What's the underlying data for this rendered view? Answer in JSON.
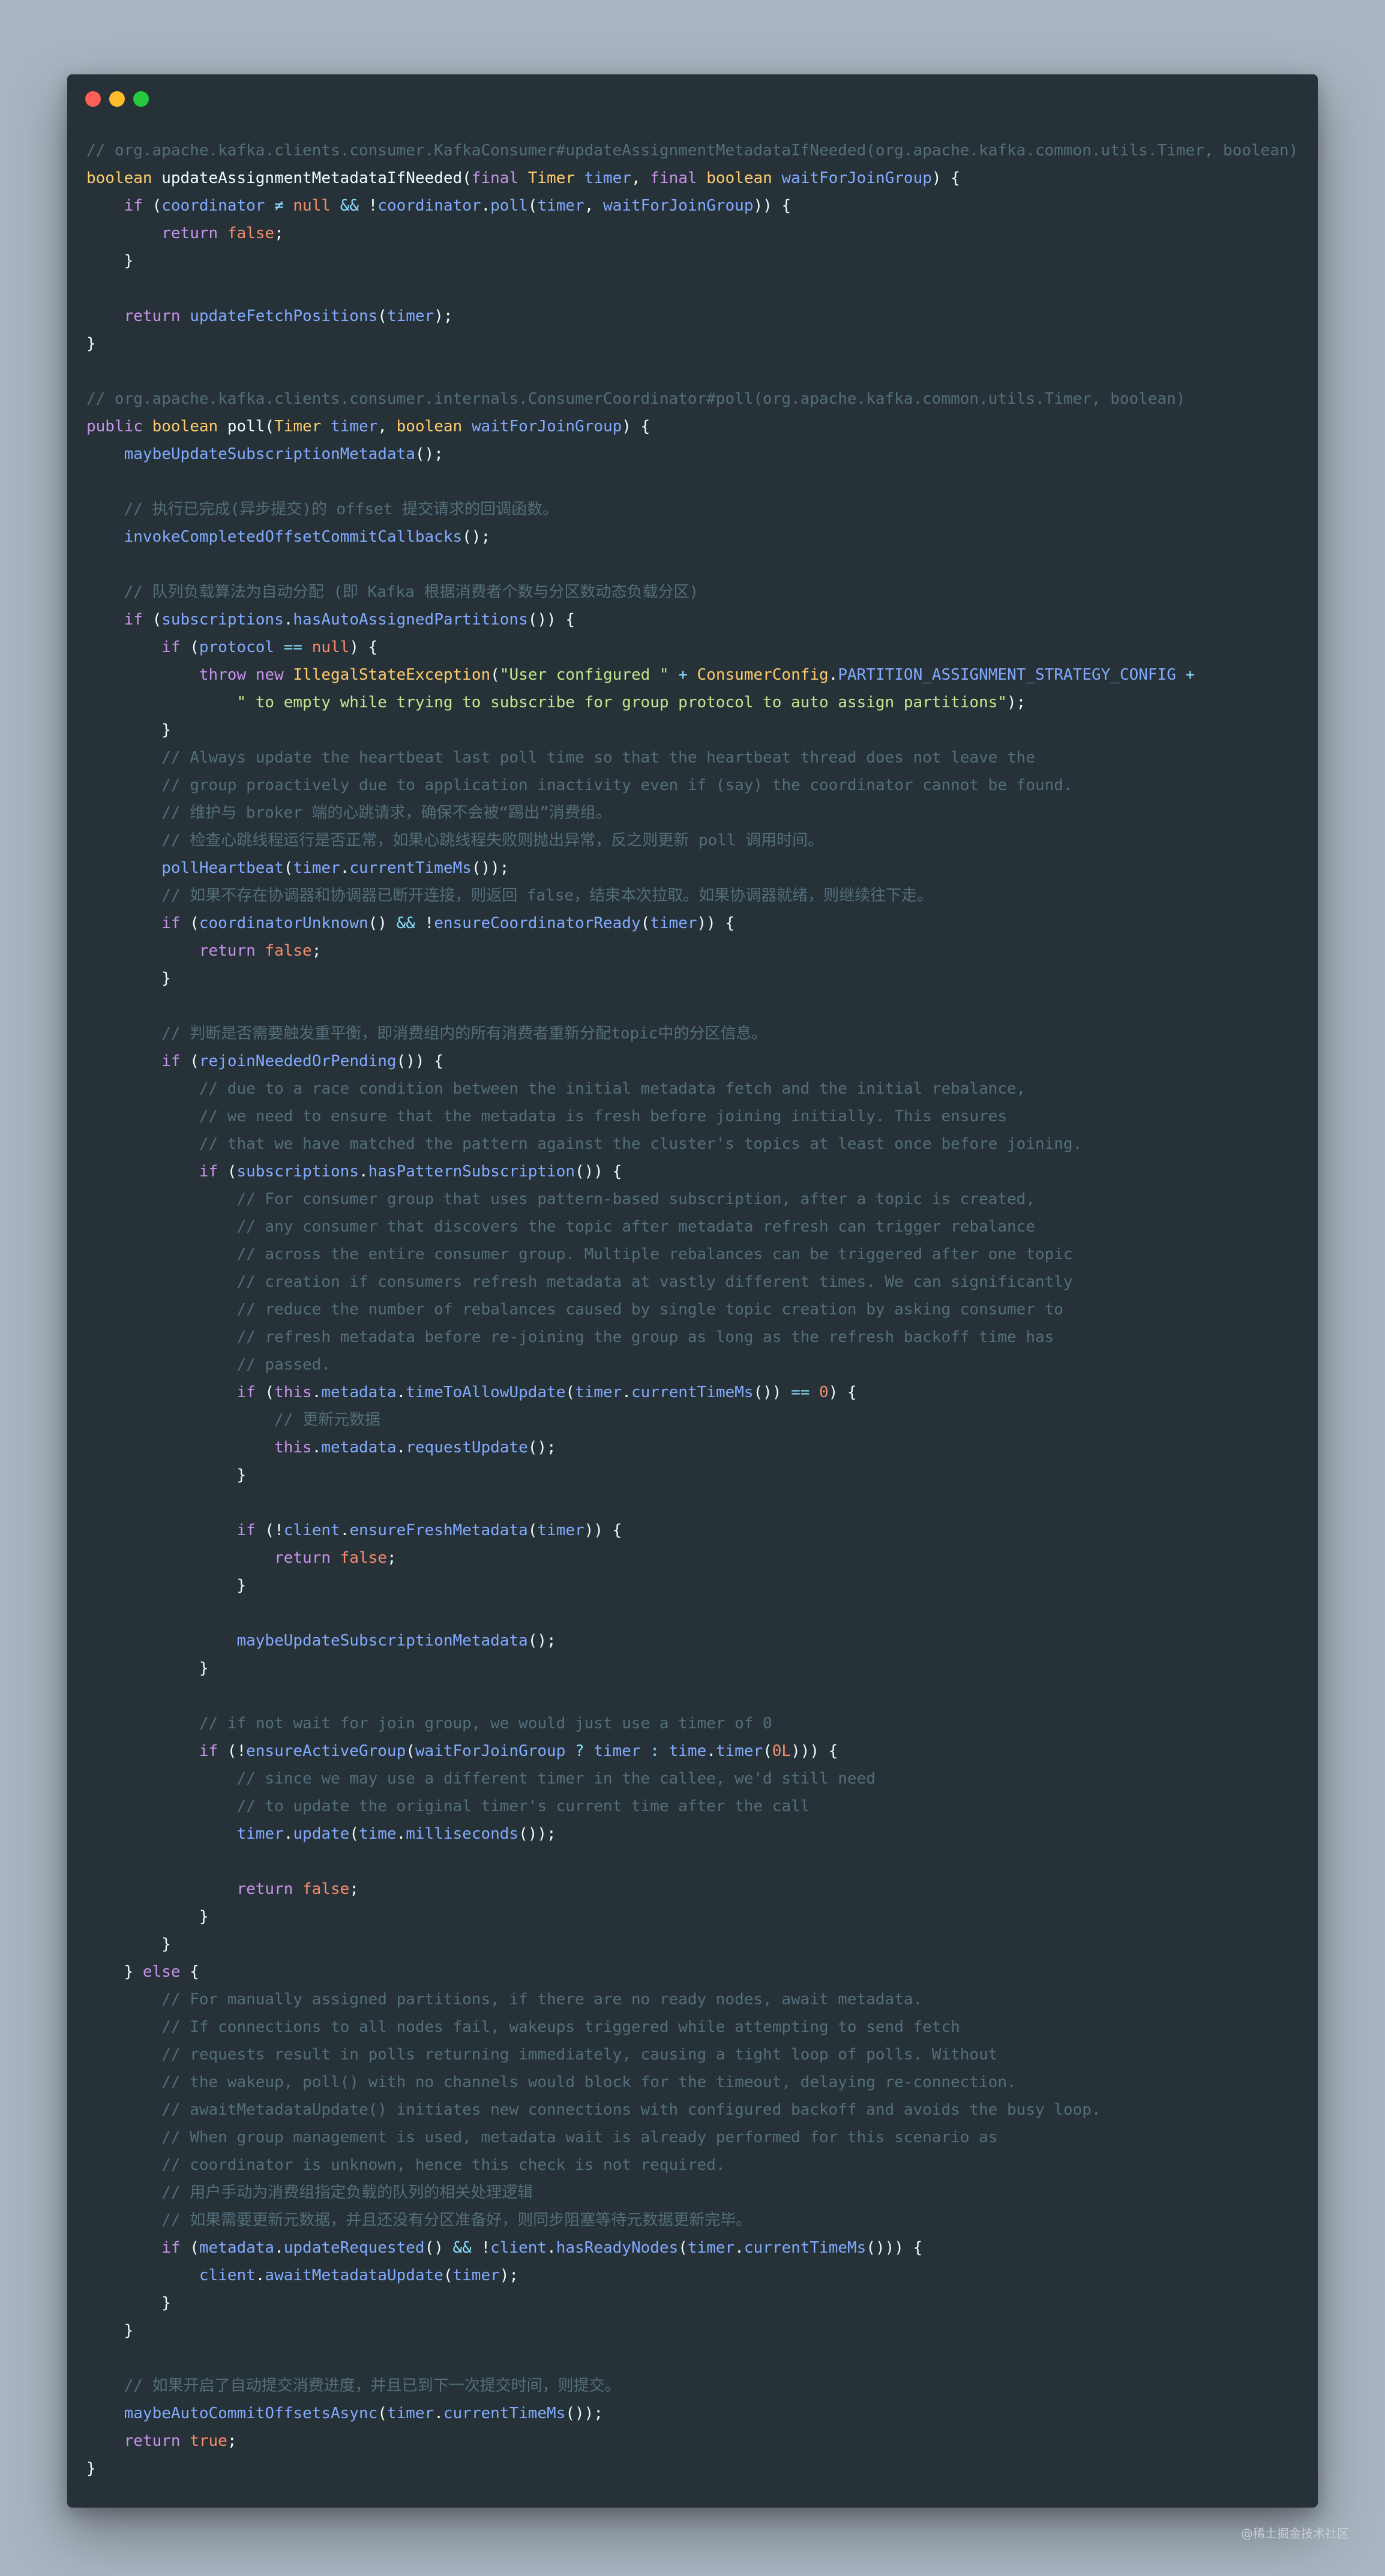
{
  "colors": {
    "background": "#a8b4c0",
    "window_bg": "#263238",
    "dot_red": "#ff5f56",
    "dot_yellow": "#ffbd2e",
    "dot_green": "#27c93f",
    "comment": "#546e7a",
    "keyword": "#c792ea",
    "type": "#ffcb6b",
    "field": "#82aaff",
    "string": "#c3e88d",
    "number": "#f78c6c",
    "operator": "#89ddff",
    "text": "#eeffff"
  },
  "window": {
    "controls": [
      "close-dot",
      "minimize-dot",
      "maximize-dot"
    ]
  },
  "watermark": "@稀土掘金技术社区",
  "code_lines": [
    [
      [
        "c",
        "// org.apache.kafka.clients.consumer.KafkaConsumer#updateAssignmentMetadataIfNeeded(org.apache.kafka.common.utils.Timer, boolean)"
      ]
    ],
    [
      [
        "t",
        "boolean"
      ],
      [
        "x",
        " updateAssignmentMetadataIfNeeded("
      ],
      [
        "k",
        "final"
      ],
      [
        "x",
        " "
      ],
      [
        "t",
        "Timer"
      ],
      [
        "x",
        " "
      ],
      [
        "p",
        "timer"
      ],
      [
        "x",
        ", "
      ],
      [
        "k",
        "final"
      ],
      [
        "x",
        " "
      ],
      [
        "t",
        "boolean"
      ],
      [
        "x",
        " "
      ],
      [
        "p",
        "waitForJoinGroup"
      ],
      [
        "x",
        ") {"
      ]
    ],
    [
      [
        "x",
        "    "
      ],
      [
        "k",
        "if"
      ],
      [
        "x",
        " ("
      ],
      [
        "f",
        "coordinator"
      ],
      [
        "x",
        " "
      ],
      [
        "o",
        "≠"
      ],
      [
        "x",
        " "
      ],
      [
        "n",
        "null"
      ],
      [
        "x",
        " "
      ],
      [
        "o",
        "&&"
      ],
      [
        "x",
        " !"
      ],
      [
        "f",
        "coordinator"
      ],
      [
        "x",
        "."
      ],
      [
        "m",
        "poll"
      ],
      [
        "x",
        "("
      ],
      [
        "p",
        "timer"
      ],
      [
        "x",
        ", "
      ],
      [
        "p",
        "waitForJoinGroup"
      ],
      [
        "x",
        ")) {"
      ]
    ],
    [
      [
        "x",
        "        "
      ],
      [
        "k",
        "return"
      ],
      [
        "x",
        " "
      ],
      [
        "n",
        "false"
      ],
      [
        "x",
        ";"
      ]
    ],
    [
      [
        "x",
        "    }"
      ]
    ],
    [],
    [
      [
        "x",
        "    "
      ],
      [
        "k",
        "return"
      ],
      [
        "x",
        " "
      ],
      [
        "m",
        "updateFetchPositions"
      ],
      [
        "x",
        "("
      ],
      [
        "p",
        "timer"
      ],
      [
        "x",
        ");"
      ]
    ],
    [
      [
        "x",
        "}"
      ]
    ],
    [],
    [
      [
        "c",
        "// org.apache.kafka.clients.consumer.internals.ConsumerCoordinator#poll(org.apache.kafka.common.utils.Timer, boolean)"
      ]
    ],
    [
      [
        "k",
        "public"
      ],
      [
        "x",
        " "
      ],
      [
        "t",
        "boolean"
      ],
      [
        "x",
        " poll("
      ],
      [
        "t",
        "Timer"
      ],
      [
        "x",
        " "
      ],
      [
        "p",
        "timer"
      ],
      [
        "x",
        ", "
      ],
      [
        "t",
        "boolean"
      ],
      [
        "x",
        " "
      ],
      [
        "p",
        "waitForJoinGroup"
      ],
      [
        "x",
        ") {"
      ]
    ],
    [
      [
        "x",
        "    "
      ],
      [
        "m",
        "maybeUpdateSubscriptionMetadata"
      ],
      [
        "x",
        "();"
      ]
    ],
    [],
    [
      [
        "x",
        "    "
      ],
      [
        "c",
        "// 执行已完成(异步提交)的 offset 提交请求的回调函数。"
      ]
    ],
    [
      [
        "x",
        "    "
      ],
      [
        "m",
        "invokeCompletedOffsetCommitCallbacks"
      ],
      [
        "x",
        "();"
      ]
    ],
    [],
    [
      [
        "x",
        "    "
      ],
      [
        "c",
        "// 队列负载算法为自动分配 (即 Kafka 根据消费者个数与分区数动态负载分区)"
      ]
    ],
    [
      [
        "x",
        "    "
      ],
      [
        "k",
        "if"
      ],
      [
        "x",
        " ("
      ],
      [
        "f",
        "subscriptions"
      ],
      [
        "x",
        "."
      ],
      [
        "m",
        "hasAutoAssignedPartitions"
      ],
      [
        "x",
        "()) {"
      ]
    ],
    [
      [
        "x",
        "        "
      ],
      [
        "k",
        "if"
      ],
      [
        "x",
        " ("
      ],
      [
        "f",
        "protocol"
      ],
      [
        "x",
        " "
      ],
      [
        "o",
        "=="
      ],
      [
        "x",
        " "
      ],
      [
        "n",
        "null"
      ],
      [
        "x",
        ") {"
      ]
    ],
    [
      [
        "x",
        "            "
      ],
      [
        "k",
        "throw"
      ],
      [
        "x",
        " "
      ],
      [
        "k",
        "new"
      ],
      [
        "x",
        " "
      ],
      [
        "t",
        "IllegalStateException"
      ],
      [
        "x",
        "("
      ],
      [
        "s",
        "\"User configured \""
      ],
      [
        "x",
        " "
      ],
      [
        "o",
        "+"
      ],
      [
        "x",
        " "
      ],
      [
        "t",
        "ConsumerConfig"
      ],
      [
        "x",
        "."
      ],
      [
        "f",
        "PARTITION_ASSIGNMENT_STRATEGY_CONFIG"
      ],
      [
        "x",
        " "
      ],
      [
        "o",
        "+"
      ]
    ],
    [
      [
        "x",
        "                "
      ],
      [
        "s",
        "\" to empty while trying to subscribe for group protocol to auto assign partitions\""
      ],
      [
        "x",
        ");"
      ]
    ],
    [
      [
        "x",
        "        }"
      ]
    ],
    [
      [
        "x",
        "        "
      ],
      [
        "c",
        "// Always update the heartbeat last poll time so that the heartbeat thread does not leave the"
      ]
    ],
    [
      [
        "x",
        "        "
      ],
      [
        "c",
        "// group proactively due to application inactivity even if (say) the coordinator cannot be found."
      ]
    ],
    [
      [
        "x",
        "        "
      ],
      [
        "c",
        "// 维护与 broker 端的心跳请求，确保不会被“踢出”消费组。"
      ]
    ],
    [
      [
        "x",
        "        "
      ],
      [
        "c",
        "// 检查心跳线程运行是否正常，如果心跳线程失败则抛出异常，反之则更新 poll 调用时间。"
      ]
    ],
    [
      [
        "x",
        "        "
      ],
      [
        "m",
        "pollHeartbeat"
      ],
      [
        "x",
        "("
      ],
      [
        "p",
        "timer"
      ],
      [
        "x",
        "."
      ],
      [
        "m",
        "currentTimeMs"
      ],
      [
        "x",
        "());"
      ]
    ],
    [
      [
        "x",
        "        "
      ],
      [
        "c",
        "// 如果不存在协调器和协调器已断开连接，则返回 false，结束本次拉取。如果协调器就绪，则继续往下走。"
      ]
    ],
    [
      [
        "x",
        "        "
      ],
      [
        "k",
        "if"
      ],
      [
        "x",
        " ("
      ],
      [
        "m",
        "coordinatorUnknown"
      ],
      [
        "x",
        "() "
      ],
      [
        "o",
        "&&"
      ],
      [
        "x",
        " !"
      ],
      [
        "m",
        "ensureCoordinatorReady"
      ],
      [
        "x",
        "("
      ],
      [
        "p",
        "timer"
      ],
      [
        "x",
        ")) {"
      ]
    ],
    [
      [
        "x",
        "            "
      ],
      [
        "k",
        "return"
      ],
      [
        "x",
        " "
      ],
      [
        "n",
        "false"
      ],
      [
        "x",
        ";"
      ]
    ],
    [
      [
        "x",
        "        }"
      ]
    ],
    [],
    [
      [
        "x",
        "        "
      ],
      [
        "c",
        "// 判断是否需要触发重平衡，即消费组内的所有消费者重新分配topic中的分区信息。"
      ]
    ],
    [
      [
        "x",
        "        "
      ],
      [
        "k",
        "if"
      ],
      [
        "x",
        " ("
      ],
      [
        "m",
        "rejoinNeededOrPending"
      ],
      [
        "x",
        "()) {"
      ]
    ],
    [
      [
        "x",
        "            "
      ],
      [
        "c",
        "// due to a race condition between the initial metadata fetch and the initial rebalance,"
      ]
    ],
    [
      [
        "x",
        "            "
      ],
      [
        "c",
        "// we need to ensure that the metadata is fresh before joining initially. This ensures"
      ]
    ],
    [
      [
        "x",
        "            "
      ],
      [
        "c",
        "// that we have matched the pattern against the cluster's topics at least once before joining."
      ]
    ],
    [
      [
        "x",
        "            "
      ],
      [
        "k",
        "if"
      ],
      [
        "x",
        " ("
      ],
      [
        "f",
        "subscriptions"
      ],
      [
        "x",
        "."
      ],
      [
        "m",
        "hasPatternSubscription"
      ],
      [
        "x",
        "()) {"
      ]
    ],
    [
      [
        "x",
        "                "
      ],
      [
        "c",
        "// For consumer group that uses pattern-based subscription, after a topic is created,"
      ]
    ],
    [
      [
        "x",
        "                "
      ],
      [
        "c",
        "// any consumer that discovers the topic after metadata refresh can trigger rebalance"
      ]
    ],
    [
      [
        "x",
        "                "
      ],
      [
        "c",
        "// across the entire consumer group. Multiple rebalances can be triggered after one topic"
      ]
    ],
    [
      [
        "x",
        "                "
      ],
      [
        "c",
        "// creation if consumers refresh metadata at vastly different times. We can significantly"
      ]
    ],
    [
      [
        "x",
        "                "
      ],
      [
        "c",
        "// reduce the number of rebalances caused by single topic creation by asking consumer to"
      ]
    ],
    [
      [
        "x",
        "                "
      ],
      [
        "c",
        "// refresh metadata before re-joining the group as long as the refresh backoff time has"
      ]
    ],
    [
      [
        "x",
        "                "
      ],
      [
        "c",
        "// passed."
      ]
    ],
    [
      [
        "x",
        "                "
      ],
      [
        "k",
        "if"
      ],
      [
        "x",
        " ("
      ],
      [
        "k",
        "this"
      ],
      [
        "x",
        "."
      ],
      [
        "f",
        "metadata"
      ],
      [
        "x",
        "."
      ],
      [
        "m",
        "timeToAllowUpdate"
      ],
      [
        "x",
        "("
      ],
      [
        "p",
        "timer"
      ],
      [
        "x",
        "."
      ],
      [
        "m",
        "currentTimeMs"
      ],
      [
        "x",
        "()) "
      ],
      [
        "o",
        "=="
      ],
      [
        "x",
        " "
      ],
      [
        "n",
        "0"
      ],
      [
        "x",
        ") {"
      ]
    ],
    [
      [
        "x",
        "                    "
      ],
      [
        "c",
        "// 更新元数据"
      ]
    ],
    [
      [
        "x",
        "                    "
      ],
      [
        "k",
        "this"
      ],
      [
        "x",
        "."
      ],
      [
        "f",
        "metadata"
      ],
      [
        "x",
        "."
      ],
      [
        "m",
        "requestUpdate"
      ],
      [
        "x",
        "();"
      ]
    ],
    [
      [
        "x",
        "                }"
      ]
    ],
    [],
    [
      [
        "x",
        "                "
      ],
      [
        "k",
        "if"
      ],
      [
        "x",
        " (!"
      ],
      [
        "f",
        "client"
      ],
      [
        "x",
        "."
      ],
      [
        "m",
        "ensureFreshMetadata"
      ],
      [
        "x",
        "("
      ],
      [
        "p",
        "timer"
      ],
      [
        "x",
        ")) {"
      ]
    ],
    [
      [
        "x",
        "                    "
      ],
      [
        "k",
        "return"
      ],
      [
        "x",
        " "
      ],
      [
        "n",
        "false"
      ],
      [
        "x",
        ";"
      ]
    ],
    [
      [
        "x",
        "                }"
      ]
    ],
    [],
    [
      [
        "x",
        "                "
      ],
      [
        "m",
        "maybeUpdateSubscriptionMetadata"
      ],
      [
        "x",
        "();"
      ]
    ],
    [
      [
        "x",
        "            }"
      ]
    ],
    [],
    [
      [
        "x",
        "            "
      ],
      [
        "c",
        "// if not wait for join group, we would just use a timer of 0"
      ]
    ],
    [
      [
        "x",
        "            "
      ],
      [
        "k",
        "if"
      ],
      [
        "x",
        " (!"
      ],
      [
        "m",
        "ensureActiveGroup"
      ],
      [
        "x",
        "("
      ],
      [
        "p",
        "waitForJoinGroup"
      ],
      [
        "x",
        " "
      ],
      [
        "o",
        "?"
      ],
      [
        "x",
        " "
      ],
      [
        "p",
        "timer"
      ],
      [
        "x",
        " "
      ],
      [
        "o",
        ":"
      ],
      [
        "x",
        " "
      ],
      [
        "f",
        "time"
      ],
      [
        "x",
        "."
      ],
      [
        "m",
        "timer"
      ],
      [
        "x",
        "("
      ],
      [
        "n",
        "0L"
      ],
      [
        "x",
        "))) {"
      ]
    ],
    [
      [
        "x",
        "                "
      ],
      [
        "c",
        "// since we may use a different timer in the callee, we'd still need"
      ]
    ],
    [
      [
        "x",
        "                "
      ],
      [
        "c",
        "// to update the original timer's current time after the call"
      ]
    ],
    [
      [
        "x",
        "                "
      ],
      [
        "p",
        "timer"
      ],
      [
        "x",
        "."
      ],
      [
        "m",
        "update"
      ],
      [
        "x",
        "("
      ],
      [
        "f",
        "time"
      ],
      [
        "x",
        "."
      ],
      [
        "m",
        "milliseconds"
      ],
      [
        "x",
        "());"
      ]
    ],
    [],
    [
      [
        "x",
        "                "
      ],
      [
        "k",
        "return"
      ],
      [
        "x",
        " "
      ],
      [
        "n",
        "false"
      ],
      [
        "x",
        ";"
      ]
    ],
    [
      [
        "x",
        "            }"
      ]
    ],
    [
      [
        "x",
        "        }"
      ]
    ],
    [
      [
        "x",
        "    } "
      ],
      [
        "k",
        "else"
      ],
      [
        "x",
        " {"
      ]
    ],
    [
      [
        "x",
        "        "
      ],
      [
        "c",
        "// For manually assigned partitions, if there are no ready nodes, await metadata."
      ]
    ],
    [
      [
        "x",
        "        "
      ],
      [
        "c",
        "// If connections to all nodes fail, wakeups triggered while attempting to send fetch"
      ]
    ],
    [
      [
        "x",
        "        "
      ],
      [
        "c",
        "// requests result in polls returning immediately, causing a tight loop of polls. Without"
      ]
    ],
    [
      [
        "x",
        "        "
      ],
      [
        "c",
        "// the wakeup, poll() with no channels would block for the timeout, delaying re-connection."
      ]
    ],
    [
      [
        "x",
        "        "
      ],
      [
        "c",
        "// awaitMetadataUpdate() initiates new connections with configured backoff and avoids the busy loop."
      ]
    ],
    [
      [
        "x",
        "        "
      ],
      [
        "c",
        "// When group management is used, metadata wait is already performed for this scenario as"
      ]
    ],
    [
      [
        "x",
        "        "
      ],
      [
        "c",
        "// coordinator is unknown, hence this check is not required."
      ]
    ],
    [
      [
        "x",
        "        "
      ],
      [
        "c",
        "// 用户手动为消费组指定负载的队列的相关处理逻辑"
      ]
    ],
    [
      [
        "x",
        "        "
      ],
      [
        "c",
        "// 如果需要更新元数据，并且还没有分区准备好，则同步阻塞等待元数据更新完毕。"
      ]
    ],
    [
      [
        "x",
        "        "
      ],
      [
        "k",
        "if"
      ],
      [
        "x",
        " ("
      ],
      [
        "f",
        "metadata"
      ],
      [
        "x",
        "."
      ],
      [
        "m",
        "updateRequested"
      ],
      [
        "x",
        "() "
      ],
      [
        "o",
        "&&"
      ],
      [
        "x",
        " !"
      ],
      [
        "f",
        "client"
      ],
      [
        "x",
        "."
      ],
      [
        "m",
        "hasReadyNodes"
      ],
      [
        "x",
        "("
      ],
      [
        "p",
        "timer"
      ],
      [
        "x",
        "."
      ],
      [
        "m",
        "currentTimeMs"
      ],
      [
        "x",
        "())) {"
      ]
    ],
    [
      [
        "x",
        "            "
      ],
      [
        "f",
        "client"
      ],
      [
        "x",
        "."
      ],
      [
        "m",
        "awaitMetadataUpdate"
      ],
      [
        "x",
        "("
      ],
      [
        "p",
        "timer"
      ],
      [
        "x",
        ");"
      ]
    ],
    [
      [
        "x",
        "        }"
      ]
    ],
    [
      [
        "x",
        "    }"
      ]
    ],
    [],
    [
      [
        "x",
        "    "
      ],
      [
        "c",
        "// 如果开启了自动提交消费进度，并且已到下一次提交时间，则提交。"
      ]
    ],
    [
      [
        "x",
        "    "
      ],
      [
        "m",
        "maybeAutoCommitOffsetsAsync"
      ],
      [
        "x",
        "("
      ],
      [
        "p",
        "timer"
      ],
      [
        "x",
        "."
      ],
      [
        "m",
        "currentTimeMs"
      ],
      [
        "x",
        "());"
      ]
    ],
    [
      [
        "x",
        "    "
      ],
      [
        "k",
        "return"
      ],
      [
        "x",
        " "
      ],
      [
        "n",
        "true"
      ],
      [
        "x",
        ";"
      ]
    ],
    [
      [
        "x",
        "}"
      ]
    ]
  ]
}
